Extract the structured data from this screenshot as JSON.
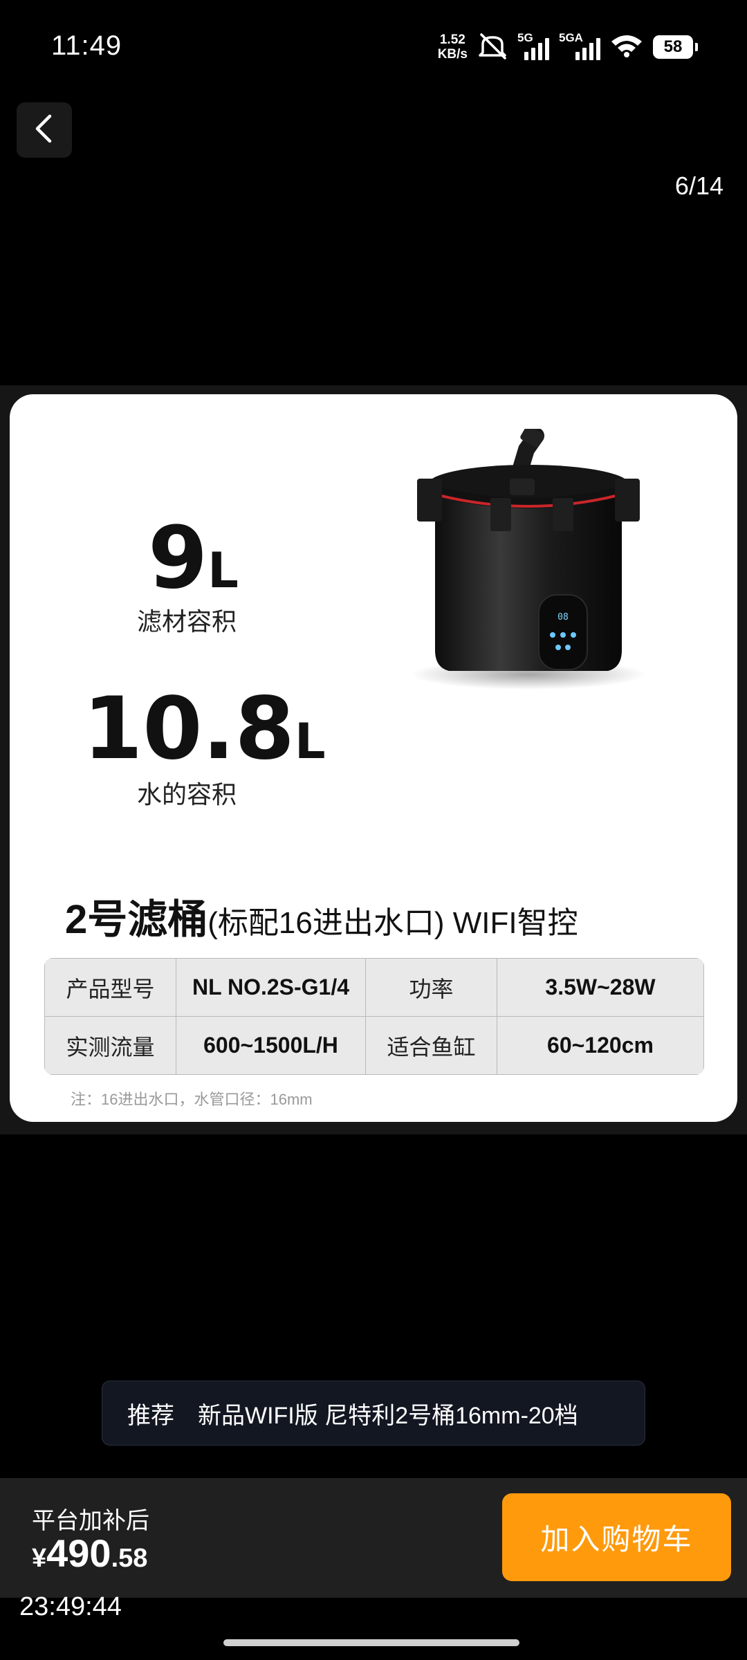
{
  "status_bar": {
    "time": "11:49",
    "net_speed_value": "1.52",
    "net_speed_unit": "KB/s",
    "sim1_label": "5G",
    "sim2_label": "5GA",
    "battery": "58"
  },
  "header": {
    "page_counter": "6/14"
  },
  "image": {
    "stat1_value": "9",
    "stat1_unit": "L",
    "stat1_label": "滤材容积",
    "stat2_value": "10.8",
    "stat2_unit": "L",
    "stat2_label": "水的容积",
    "title_main": "2号滤桶",
    "title_sub": "(标配16进出水口)",
    "title_tail": " WIFI智控",
    "device_display": "08",
    "spec_rows": [
      [
        "产品型号",
        "NL NO.2S-G1/4",
        "功率",
        "3.5W~28W"
      ],
      [
        "实测流量",
        "600~1500L/H",
        "适合鱼缸",
        "60~120cm"
      ]
    ],
    "note": "注：16进出水口，水管口径：16mm"
  },
  "recommendation": {
    "tag": "推荐",
    "text": "新品WIFI版 尼特利2号桶16mm-20档"
  },
  "bottom_bar": {
    "price_label": "平台加补后",
    "currency": "¥",
    "price_int": "490",
    "price_dec": ".58",
    "cart_button": "加入购物车"
  },
  "overlay_clock": "23:49:44",
  "icons": [
    "back-chevron-icon",
    "mute-icon",
    "signal-icon",
    "wifi-icon",
    "battery-icon"
  ]
}
